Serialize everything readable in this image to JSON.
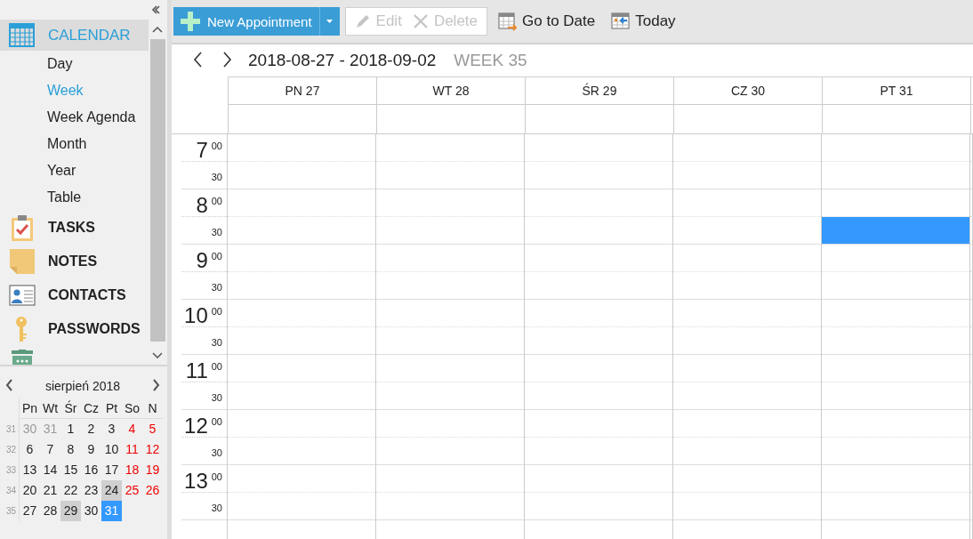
{
  "toolbar": {
    "new_button": {
      "label": "New Appointment"
    },
    "buttons": [
      {
        "kind": "edit",
        "label": "Edit",
        "disabled": true
      },
      {
        "kind": "delete",
        "label": "Delete",
        "disabled": true
      },
      {
        "kind": "goto",
        "label": "Go to Date",
        "disabled": false
      },
      {
        "kind": "today",
        "label": "Today",
        "disabled": false
      }
    ]
  },
  "sidebar": {
    "items": [
      {
        "kind": "calendar",
        "label": "CALENDAR",
        "selected": true,
        "children": [
          {
            "label": "Day",
            "selected": false
          },
          {
            "label": "Week",
            "selected": true
          },
          {
            "label": "Week Agenda",
            "selected": false
          },
          {
            "label": "Month",
            "selected": false
          },
          {
            "label": "Year",
            "selected": false
          },
          {
            "label": "Table",
            "selected": false
          }
        ]
      },
      {
        "kind": "tasks",
        "label": "TASKS",
        "selected": false
      },
      {
        "kind": "notes",
        "label": "NOTES",
        "selected": false
      },
      {
        "kind": "contacts",
        "label": "CONTACTS",
        "selected": false
      },
      {
        "kind": "passwords",
        "label": "PASSWORDS",
        "selected": false
      },
      {
        "kind": "trash",
        "selected": false
      }
    ]
  },
  "mini_calendar": {
    "month": "sierpień  2018",
    "weekdays": [
      "Pn",
      "Wt",
      "Śr",
      "Cz",
      "Pt",
      "So",
      "N"
    ],
    "weeks": [
      {
        "number": "31",
        "days": [
          {
            "day": "30",
            "kind": "other",
            "selected": false,
            "shaded": false
          },
          {
            "day": "31",
            "kind": "other",
            "selected": false,
            "shaded": false
          },
          {
            "day": "1",
            "kind": "weekday",
            "selected": false,
            "shaded": false
          },
          {
            "day": "2",
            "kind": "weekday",
            "selected": false,
            "shaded": false
          },
          {
            "day": "3",
            "kind": "weekday",
            "selected": false,
            "shaded": false
          },
          {
            "day": "4",
            "kind": "weekend",
            "selected": false,
            "shaded": false
          },
          {
            "day": "5",
            "kind": "weekend",
            "selected": false,
            "shaded": false
          }
        ]
      },
      {
        "number": "32",
        "days": [
          {
            "day": "6",
            "kind": "weekday",
            "selected": false,
            "shaded": false
          },
          {
            "day": "7",
            "kind": "weekday",
            "selected": false,
            "shaded": false
          },
          {
            "day": "8",
            "kind": "weekday",
            "selected": false,
            "shaded": false
          },
          {
            "day": "9",
            "kind": "weekday",
            "selected": false,
            "shaded": false
          },
          {
            "day": "10",
            "kind": "weekday",
            "selected": false,
            "shaded": false
          },
          {
            "day": "11",
            "kind": "weekend",
            "selected": false,
            "shaded": false
          },
          {
            "day": "12",
            "kind": "weekend",
            "selected": false,
            "shaded": false
          }
        ]
      },
      {
        "number": "33",
        "days": [
          {
            "day": "13",
            "kind": "weekday",
            "selected": false,
            "shaded": false
          },
          {
            "day": "14",
            "kind": "weekday",
            "selected": false,
            "shaded": false
          },
          {
            "day": "15",
            "kind": "weekday",
            "selected": false,
            "shaded": false
          },
          {
            "day": "16",
            "kind": "weekday",
            "selected": false,
            "shaded": false
          },
          {
            "day": "17",
            "kind": "weekday",
            "selected": false,
            "shaded": false
          },
          {
            "day": "18",
            "kind": "weekend",
            "selected": false,
            "shaded": false
          },
          {
            "day": "19",
            "kind": "weekend",
            "selected": false,
            "shaded": false
          }
        ]
      },
      {
        "number": "34",
        "days": [
          {
            "day": "20",
            "kind": "weekday",
            "selected": false,
            "shaded": false
          },
          {
            "day": "21",
            "kind": "weekday",
            "selected": false,
            "shaded": false
          },
          {
            "day": "22",
            "kind": "weekday",
            "selected": false,
            "shaded": false
          },
          {
            "day": "23",
            "kind": "weekday",
            "selected": false,
            "shaded": false
          },
          {
            "day": "24",
            "kind": "weekday",
            "selected": false,
            "shaded": true
          },
          {
            "day": "25",
            "kind": "weekend",
            "selected": false,
            "shaded": false
          },
          {
            "day": "26",
            "kind": "weekend",
            "selected": false,
            "shaded": false
          }
        ]
      },
      {
        "number": "35",
        "days": [
          {
            "day": "27",
            "kind": "weekday",
            "selected": false,
            "shaded": false
          },
          {
            "day": "28",
            "kind": "weekday",
            "selected": false,
            "shaded": false
          },
          {
            "day": "29",
            "kind": "weekday",
            "selected": false,
            "shaded": true
          },
          {
            "day": "30",
            "kind": "weekday",
            "selected": false,
            "shaded": false
          },
          {
            "day": "31",
            "kind": "weekday",
            "selected": true,
            "shaded": false
          }
        ]
      }
    ]
  },
  "week_view": {
    "range": "2018-08-27 - 2018-09-02",
    "week": "WEEK 35",
    "days": [
      {
        "label": "PN 27",
        "busy_slots": [
          false,
          false,
          false,
          false,
          false,
          false,
          false,
          false,
          false,
          false,
          false,
          false,
          false,
          false
        ]
      },
      {
        "label": "WT 28",
        "busy_slots": [
          false,
          false,
          false,
          false,
          false,
          false,
          false,
          false,
          false,
          false,
          false,
          false,
          false,
          false
        ]
      },
      {
        "label": "ŚR 29",
        "busy_slots": [
          false,
          false,
          false,
          false,
          false,
          false,
          false,
          false,
          false,
          false,
          false,
          false,
          false,
          false
        ]
      },
      {
        "label": "CZ 30",
        "busy_slots": [
          false,
          false,
          false,
          false,
          false,
          false,
          false,
          false,
          false,
          false,
          false,
          false,
          false,
          false
        ]
      },
      {
        "label": "PT 31",
        "busy_slots": [
          false,
          false,
          false,
          true,
          false,
          false,
          false,
          false,
          false,
          false,
          false,
          false,
          false,
          false
        ]
      }
    ],
    "hours": [
      {
        "hour": "7",
        "minutes": "00",
        "half": "30"
      },
      {
        "hour": "8",
        "minutes": "00",
        "half": "30"
      },
      {
        "hour": "9",
        "minutes": "00",
        "half": "30"
      },
      {
        "hour": "10",
        "minutes": "00",
        "half": "30"
      },
      {
        "hour": "11",
        "minutes": "00",
        "half": "30"
      },
      {
        "hour": "12",
        "minutes": "00",
        "half": "30"
      },
      {
        "hour": "13",
        "minutes": "00",
        "half": "30"
      }
    ]
  }
}
